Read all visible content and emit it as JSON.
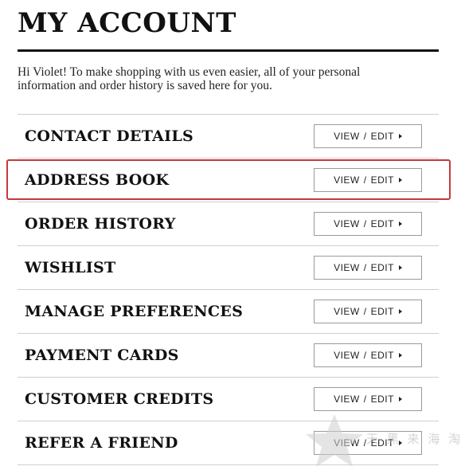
{
  "header": {
    "title": "MY ACCOUNT"
  },
  "intro": {
    "line1": "Hi Violet! To make shopping with us even easier, all of your personal",
    "line2": "information and order history is saved here for you."
  },
  "sections": [
    {
      "label": "CONTACT DETAILS",
      "view": "VIEW",
      "separator": "/",
      "edit": "EDIT"
    },
    {
      "label": "ADDRESS BOOK",
      "view": "VIEW",
      "separator": "/",
      "edit": "EDIT"
    },
    {
      "label": "ORDER HISTORY",
      "view": "VIEW",
      "separator": "/",
      "edit": "EDIT"
    },
    {
      "label": "WISHLIST",
      "view": "VIEW",
      "separator": "/",
      "edit": "EDIT"
    },
    {
      "label": "MANAGE PREFERENCES",
      "view": "VIEW",
      "separator": "/",
      "edit": "EDIT"
    },
    {
      "label": "PAYMENT CARDS",
      "view": "VIEW",
      "separator": "/",
      "edit": "EDIT"
    },
    {
      "label": "CUSTOMER CREDITS",
      "view": "VIEW",
      "separator": "/",
      "edit": "EDIT"
    },
    {
      "label": "REFER A FRIEND",
      "view": "VIEW",
      "separator": "/",
      "edit": "EDIT"
    }
  ],
  "highlighted_section": "ADDRESS BOOK",
  "watermark": {
    "text": "天 黑 来 海 淘 网",
    "icon": "star-icon"
  },
  "colors": {
    "text": "#111111",
    "highlight": "#c43a3a",
    "divider": "#cfcfcf",
    "button_border": "#9a9a9a"
  }
}
